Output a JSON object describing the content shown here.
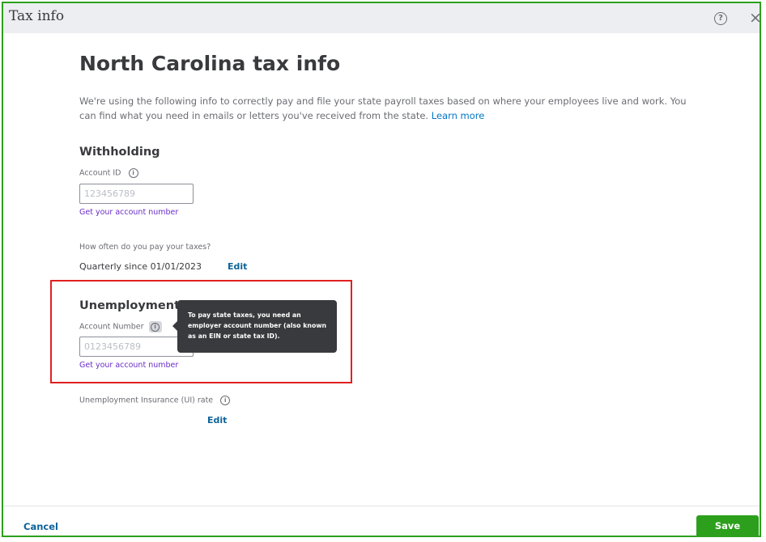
{
  "window": {
    "title": "Tax info",
    "help_icon_glyph": "?",
    "close_icon_glyph": "×"
  },
  "page": {
    "heading": "North Carolina tax info",
    "intro_text": "We're using the following info to correctly pay and file your state payroll taxes based on where your employees live and work. You can find what you need in emails or letters you've received from the state.",
    "learn_more_label": "Learn more"
  },
  "withholding": {
    "heading": "Withholding",
    "account_id_label": "Account ID",
    "account_id_placeholder": "123456789",
    "account_id_value": "",
    "get_account_link": "Get your account number",
    "frequency_label": "How often do you pay your taxes?",
    "frequency_value": "Quarterly since 01/01/2023",
    "edit_label": "Edit"
  },
  "unemployment": {
    "heading": "Unemployment In",
    "account_number_label": "Account Number",
    "account_number_placeholder": "0123456789",
    "account_number_value": "",
    "get_account_link": "Get your account number",
    "rate_label": "Unemployment Insurance (UI) rate",
    "edit_label": "Edit"
  },
  "tooltip": {
    "text": "To pay state taxes, you need an employer account number (also known as an EIN or state tax ID)."
  },
  "footer": {
    "cancel_label": "Cancel",
    "save_label": "Save"
  },
  "icons": {
    "info_glyph": "i"
  },
  "colors": {
    "primary_green": "#2ca01c",
    "link_blue": "#0077c5",
    "link_purple": "#6b2dc6",
    "annotation_red": "#e02020",
    "tooltip_bg": "#393a3d"
  }
}
